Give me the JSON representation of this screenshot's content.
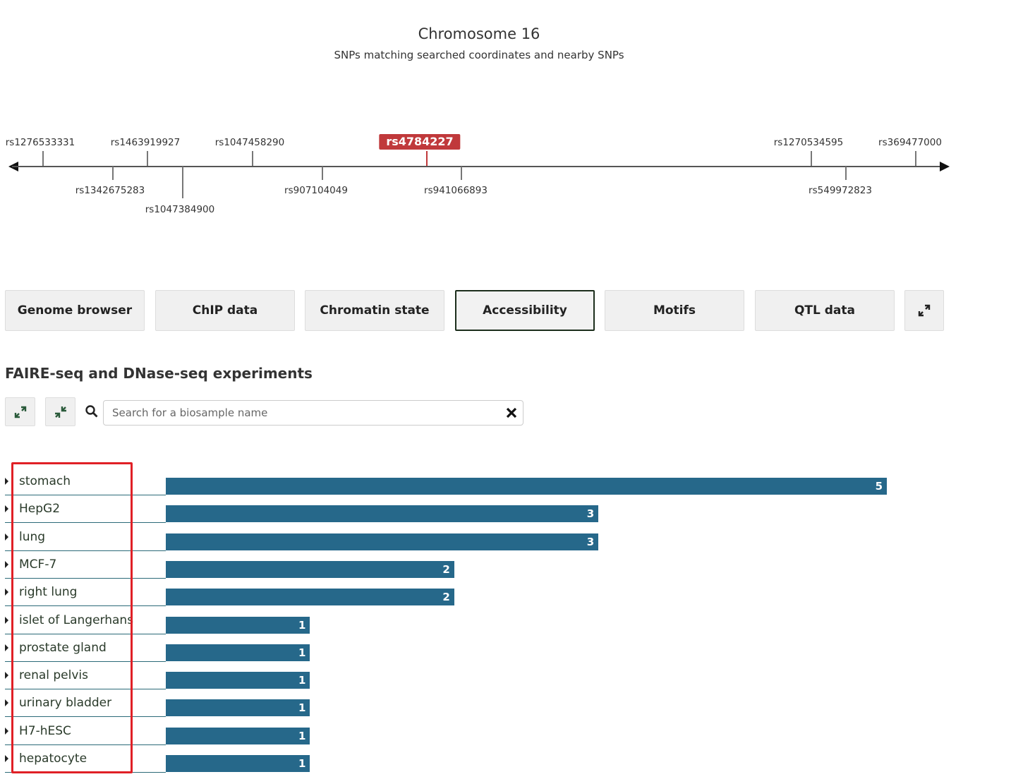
{
  "header": {
    "title": "Chromosome 16",
    "subtitle": "SNPs matching searched coordinates and nearby SNPs"
  },
  "snp_track": {
    "current": "rs4784227",
    "snps": [
      {
        "id": "rs1276533331",
        "pos": "above"
      },
      {
        "id": "rs1342675283",
        "pos": "below"
      },
      {
        "id": "rs1463919927",
        "pos": "above"
      },
      {
        "id": "rs1047384900",
        "pos": "below2"
      },
      {
        "id": "rs1047458290",
        "pos": "above"
      },
      {
        "id": "rs907104049",
        "pos": "below"
      },
      {
        "id": "rs941066893",
        "pos": "below"
      },
      {
        "id": "rs1270534595",
        "pos": "above"
      },
      {
        "id": "rs549972823",
        "pos": "below"
      },
      {
        "id": "rs369477000",
        "pos": "above"
      }
    ]
  },
  "tabs": [
    {
      "label": "Genome browser",
      "active": false
    },
    {
      "label": "ChIP data",
      "active": false
    },
    {
      "label": "Chromatin state",
      "active": false
    },
    {
      "label": "Accessibility",
      "active": true
    },
    {
      "label": "Motifs",
      "active": false
    },
    {
      "label": "QTL data",
      "active": false
    }
  ],
  "section": {
    "title": "FAIRE-seq and DNase-seq experiments",
    "search_placeholder": "Search for a biosample name"
  },
  "chart_data": {
    "type": "bar",
    "categories": [
      "stomach",
      "HepG2",
      "lung",
      "MCF-7",
      "right lung",
      "islet of Langerhans",
      "prostate gland",
      "renal pelvis",
      "urinary bladder",
      "H7-hESC",
      "hepatocyte"
    ],
    "values": [
      5,
      3,
      3,
      2,
      2,
      1,
      1,
      1,
      1,
      1,
      1
    ],
    "bar_color": "#26688a"
  },
  "colors": {
    "accent": "#c0393b",
    "highlight": "#e02026"
  }
}
